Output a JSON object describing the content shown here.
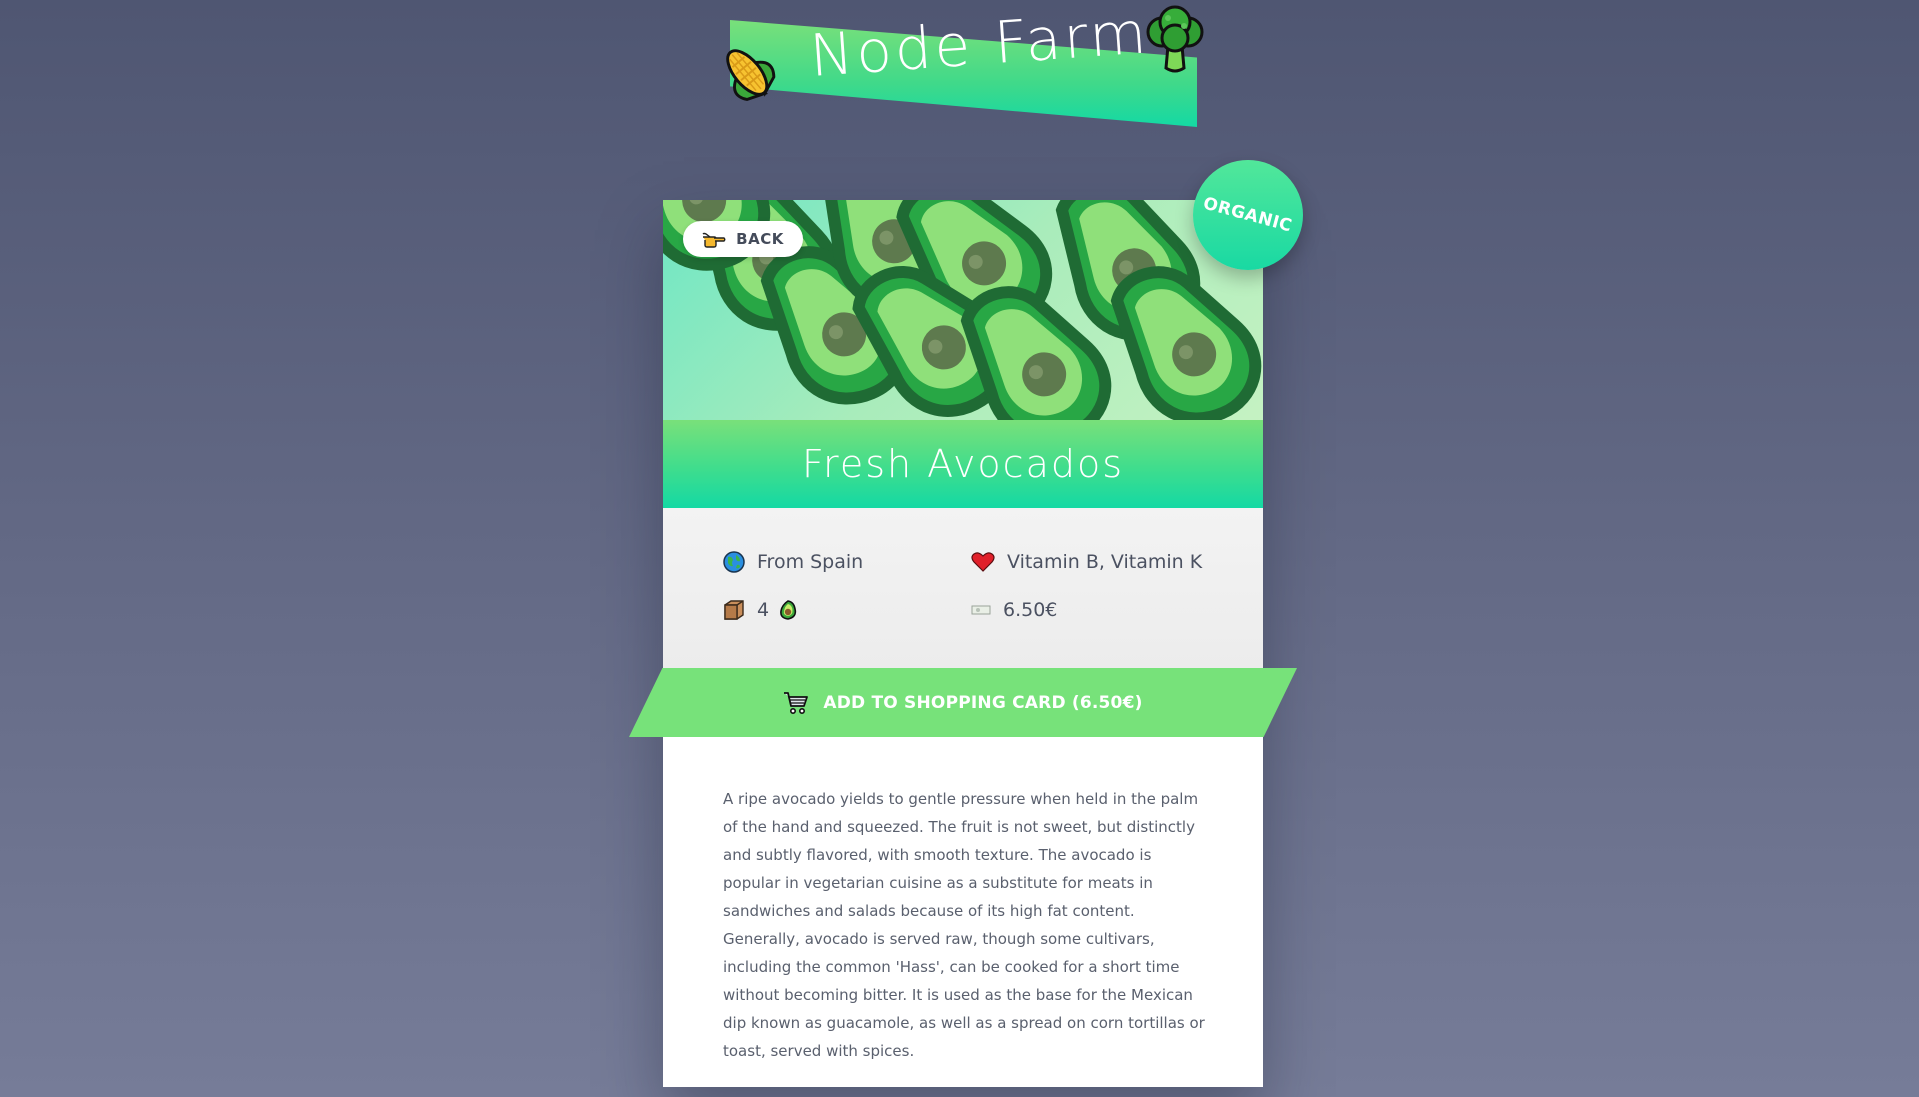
{
  "app": {
    "title": "Node Farm"
  },
  "product": {
    "back_label": "BACK",
    "badge": "ORGANIC",
    "name": "Fresh Avocados",
    "origin": "From Spain",
    "nutrients": "Vitamin B, Vitamin K",
    "quantity": "4",
    "price": "6.50€",
    "cart_label": "ADD TO SHOPPING CARD (6.50€)",
    "description": "A ripe avocado yields to gentle pressure when held in the palm of the hand and squeezed. The fruit is not sweet, but distinctly and subtly flavored, with smooth texture. The avocado is popular in vegetarian cuisine as a substitute for meats in sandwiches and salads because of its high fat content. Generally, avocado is served raw, though some cultivars, including the common 'Hass', can be cooked for a short time without becoming bitter. It is used as the base for the Mexican dip known as guacamole, as well as a spread on corn tortillas or toast, served with spices."
  },
  "icons": {
    "logo_left": "corn-icon",
    "logo_right": "broccoli-icon",
    "back": "pointing-hand-icon",
    "origin": "globe-icon",
    "nutrients": "heart-icon",
    "quantity": "box-icon",
    "quantity_unit": "avocado-icon",
    "price": "money-icon",
    "cart": "cart-icon"
  },
  "colors": {
    "background_top": "#4f5672",
    "background_bottom": "#767c98",
    "brand_green": "#77e27a",
    "brand_teal": "#14d9a4",
    "text": "#4b5161",
    "heart": "#e0202a"
  }
}
